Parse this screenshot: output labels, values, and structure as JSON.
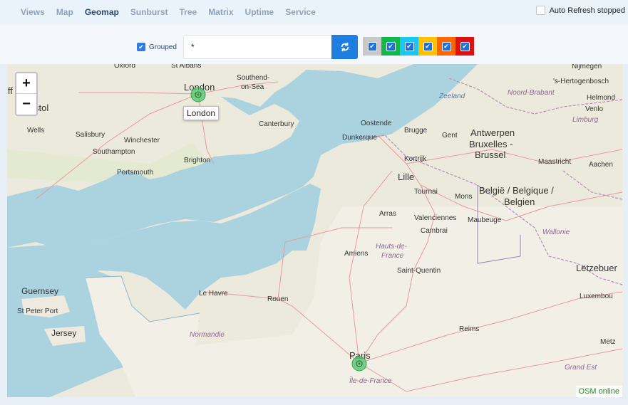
{
  "nav": {
    "tabs": [
      {
        "label": "Views"
      },
      {
        "label": "Map"
      },
      {
        "label": "Geomap",
        "active": true
      },
      {
        "label": "Sunburst"
      },
      {
        "label": "Tree"
      },
      {
        "label": "Matrix"
      },
      {
        "label": "Uptime"
      },
      {
        "label": "Service"
      }
    ],
    "auto_refresh_label": "Auto Refresh stopped"
  },
  "toolbar": {
    "grouped_label": "Grouped",
    "filter_value": "*",
    "severity_colors": [
      "#c8c8c8",
      "#11b84a",
      "#19c7f2",
      "#ffc000",
      "#ff6600",
      "#dd1111"
    ]
  },
  "map": {
    "zoom_in": "+",
    "zoom_out": "−",
    "popup_label": "London",
    "attribution": "OSM online",
    "marker_color": "#4cc46a",
    "labels": {
      "oxford": "Oxford",
      "st_albans": "St Albans",
      "london": "London",
      "southend": "Southend-",
      "on_sea": "on-Sea",
      "bristol": "stol",
      "cardiff": "iff",
      "wells": "Wells",
      "salisbury": "Salisbury",
      "winchester": "Winchester",
      "canterbury": "Canterbury",
      "southampton": "Southampton",
      "portsmouth": "Portsmouth",
      "brighton": "Brighton",
      "oostende": "Oostende",
      "brugge": "Brugge",
      "gent": "Gent",
      "antwerpen": "Antwerpen",
      "dunkerque": "Dunkerque",
      "bruxelles1": "Bruxelles -",
      "bruxelles2": "Brussel",
      "kortrijk": "Kortrijk",
      "lille": "Lille",
      "tournai": "Tournai",
      "mons": "Mons",
      "belgie1": "België / Belgique /",
      "belgie2": "Belgien",
      "maastricht": "Maastricht",
      "aachen": "Aachen",
      "arras": "Arras",
      "valenciennes": "Valenciennes",
      "cambrai": "Cambrai",
      "maubeuge": "Maubeuge",
      "wallonie": "Wallonie",
      "hauts1": "Hauts-de-",
      "hauts2": "France",
      "amiens": "Amiens",
      "saint_quentin": "Saint-Quentin",
      "letzebuerg": "Lëtzebuer",
      "luxembourg": "Luxembou",
      "guernsey": "Guernsey",
      "st_peter_port": "St Peter Port",
      "jersey": "Jersey",
      "le_havre": "Le Havre",
      "rouen": "Rouen",
      "normandie": "Normandie",
      "reims": "Reims",
      "metz": "Metz",
      "grand_est": "Grand Est",
      "paris": "Paris",
      "ile_de_france": "Île-de-France",
      "zeeland": "Zeeland",
      "noord_brabant": "Noord-Brabant",
      "nijmegen": "Nijmegen",
      "hertogenbosch": "'s-Hertogenbosch",
      "helmond": "Helmond",
      "venlo": "Venlo",
      "limburg": "Limburg"
    }
  }
}
